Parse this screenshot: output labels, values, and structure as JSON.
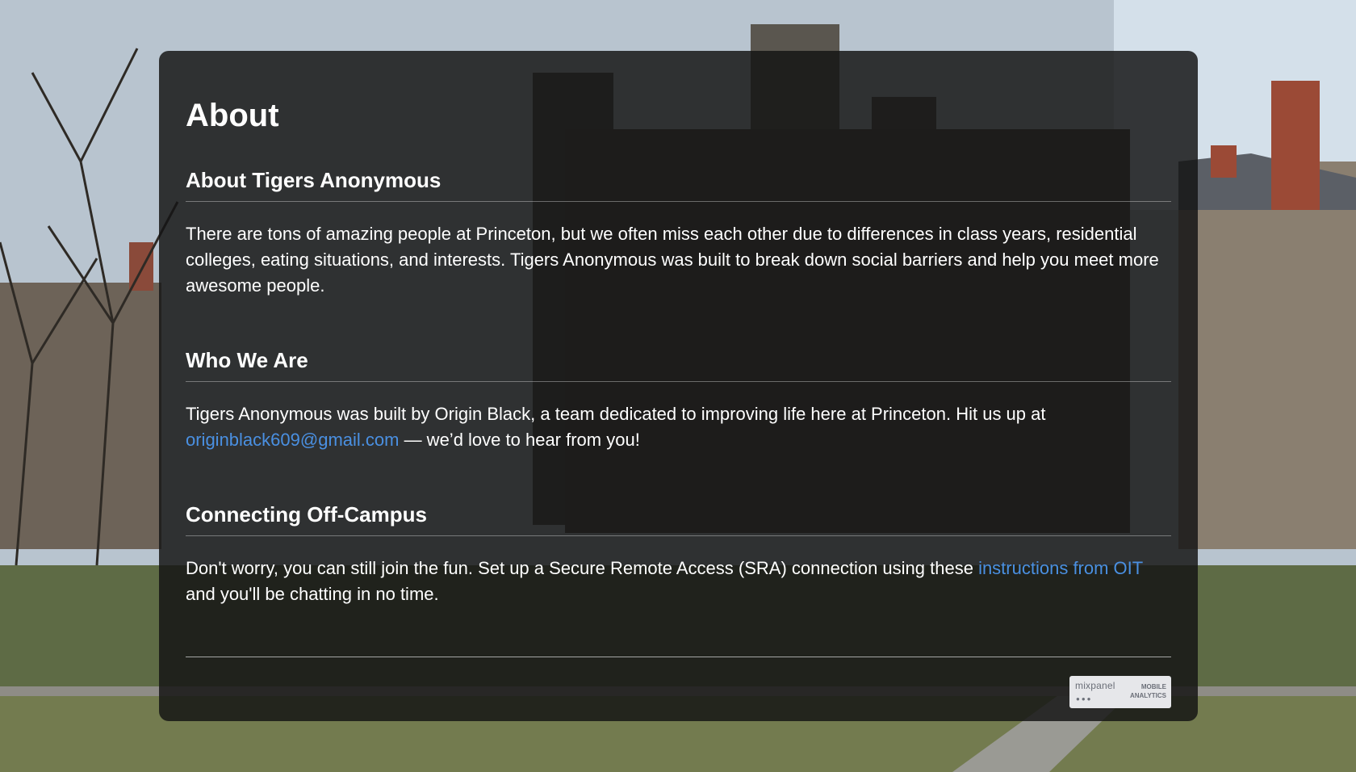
{
  "page": {
    "title": "About"
  },
  "sections": [
    {
      "heading": "About Tigers Anonymous",
      "body": "There are tons of amazing people at Princeton, but we often miss each other due to differences in class years, residential colleges, eating situations, and interests. Tigers Anonymous was built to break down social barriers and help you meet more awesome people."
    },
    {
      "heading": "Who We Are",
      "body_before": "Tigers Anonymous was built by Origin Black, a team dedicated to improving life here at Princeton. Hit us up at ",
      "link": "originblack609@gmail.com",
      "body_after": " — we’d love to hear from you!"
    },
    {
      "heading": "Connecting Off-Campus",
      "body_before": "Don't worry, you can still join the fun. Set up a Secure Remote Access (SRA) connection using these ",
      "link": "instructions from OIT",
      "body_after": " and you'll be chatting in no time."
    }
  ],
  "badge": {
    "brand": "mixpanel",
    "sub": "MOBILE\nANALYTICS",
    "dots": "●●●"
  },
  "colors": {
    "link": "#4a90e2",
    "panel": "#141414",
    "text": "#ffffff"
  }
}
